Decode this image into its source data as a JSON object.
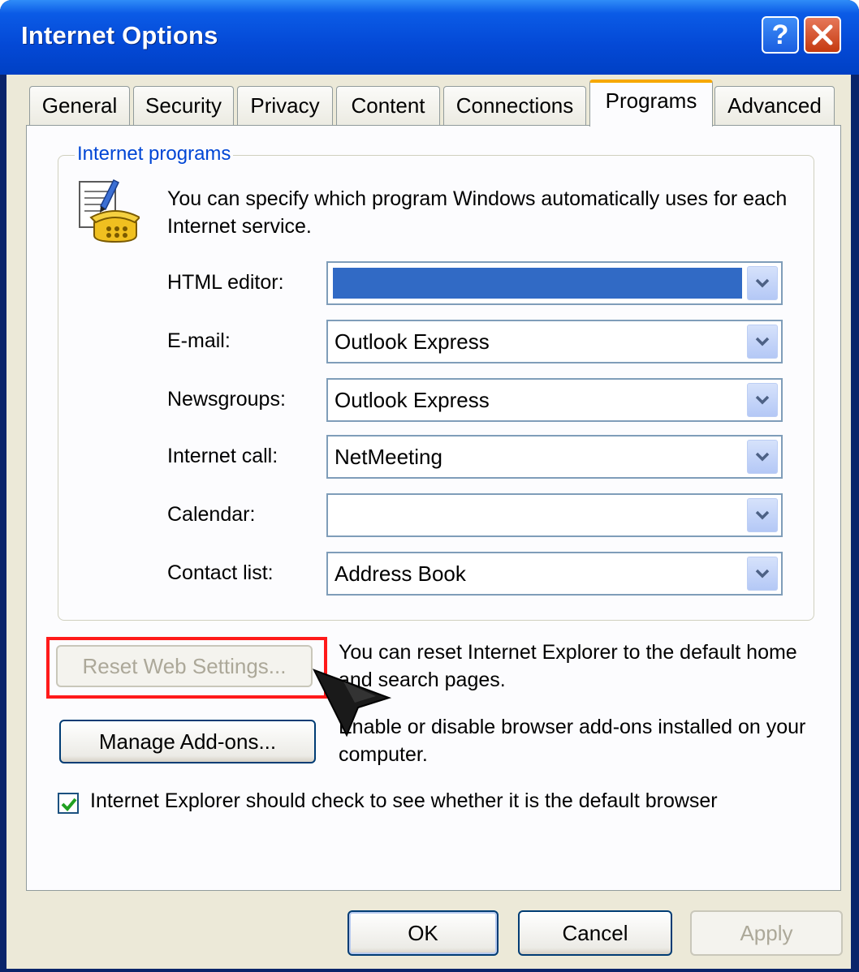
{
  "window": {
    "title": "Internet Options",
    "help_label": "?",
    "close_label": "✕"
  },
  "tabs": [
    {
      "label": "General"
    },
    {
      "label": "Security"
    },
    {
      "label": "Privacy"
    },
    {
      "label": "Content"
    },
    {
      "label": "Connections"
    },
    {
      "label": "Programs"
    },
    {
      "label": "Advanced"
    }
  ],
  "active_tab": "Programs",
  "internet_programs": {
    "legend": "Internet programs",
    "description": "You can specify which program Windows automatically uses for each Internet service.",
    "rows": [
      {
        "label": "HTML editor:",
        "value": ""
      },
      {
        "label": "E-mail:",
        "value": "Outlook Express"
      },
      {
        "label": "Newsgroups:",
        "value": "Outlook Express"
      },
      {
        "label": "Internet call:",
        "value": "NetMeeting"
      },
      {
        "label": "Calendar:",
        "value": ""
      },
      {
        "label": "Contact list:",
        "value": "Address Book"
      }
    ]
  },
  "reset": {
    "button_label": "Reset Web Settings...",
    "description": "You can reset Internet Explorer to the default home and search pages."
  },
  "addons": {
    "button_label": "Manage Add-ons...",
    "description": "Enable or disable browser add-ons installed on your computer."
  },
  "default_browser_check": {
    "label": "Internet Explorer should check to see whether it is the default browser",
    "checked": true
  },
  "footer": {
    "ok_label": "OK",
    "cancel_label": "Cancel",
    "apply_label": "Apply"
  },
  "colors": {
    "title_bar": "#0449d6",
    "dialog_bg": "#ece9d8",
    "highlight": "#ff1a1a",
    "selection": "#316ac5"
  }
}
